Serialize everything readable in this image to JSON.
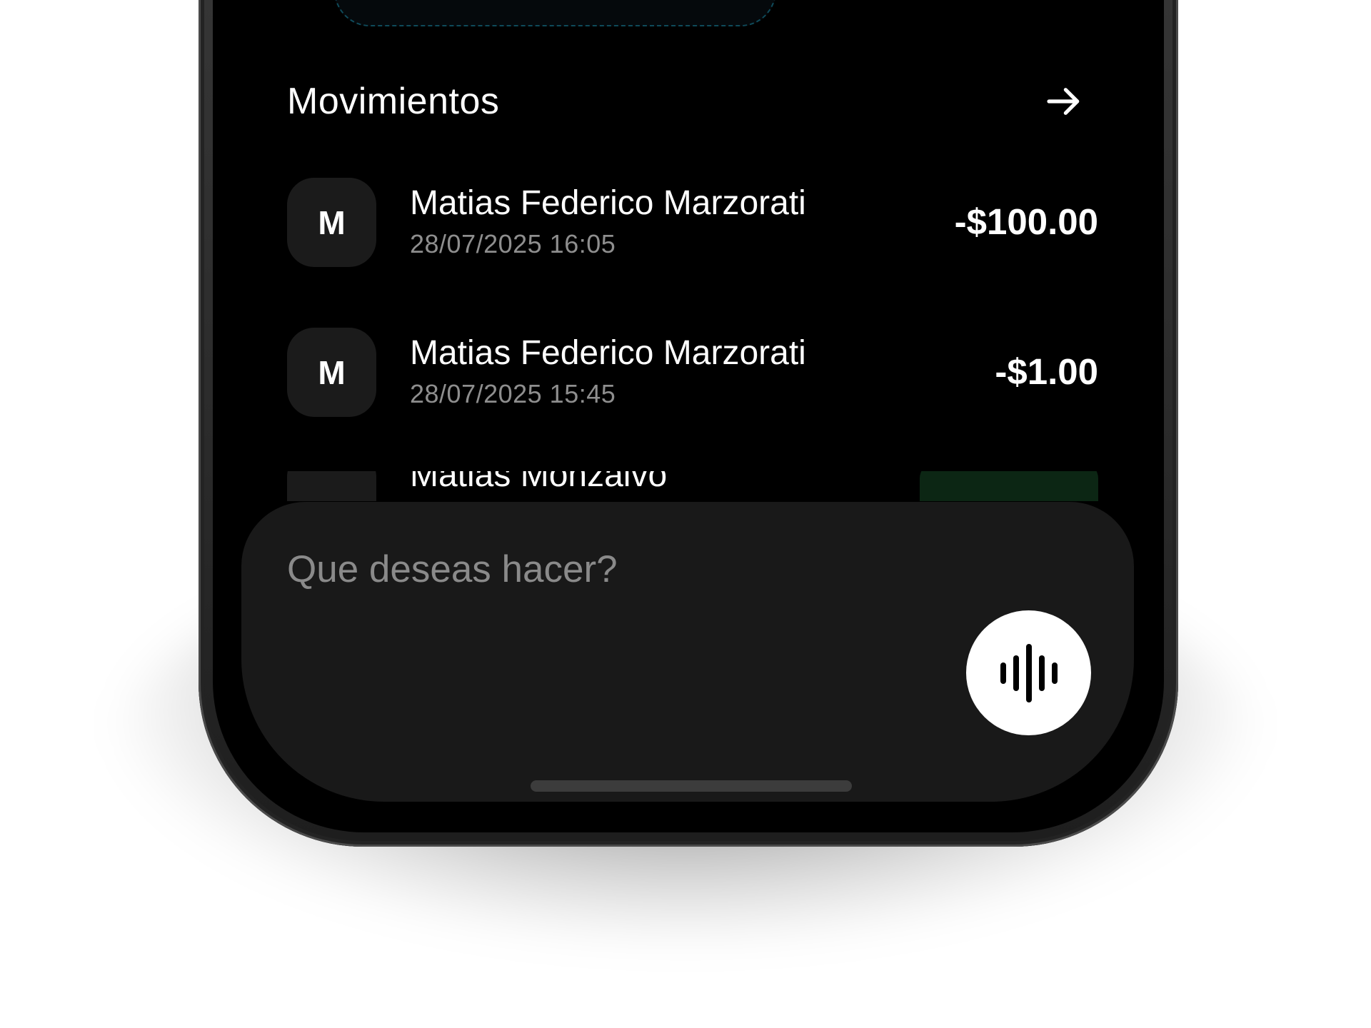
{
  "movements": {
    "title": "Movimientos",
    "see_all_icon": "arrow-right-icon",
    "items": [
      {
        "initial": "M",
        "name": "Matias Federico Marzorati",
        "date": "28/07/2025 16:05",
        "amount": "-$100.00"
      },
      {
        "initial": "M",
        "name": "Matias Federico Marzorati",
        "date": "28/07/2025 15:45",
        "amount": "-$1.00"
      },
      {
        "initial": "",
        "name": "Matias Monzalvo",
        "date": "",
        "amount": ""
      }
    ]
  },
  "assistant": {
    "placeholder": "Que deseas hacer?",
    "voice_icon": "voice-waveform-icon"
  },
  "colors": {
    "background": "#000000",
    "panel": "#191919",
    "avatar_bg": "#1b1b1b",
    "secondary_text": "#8e8e8e",
    "positive_badge": "#0c2614"
  }
}
